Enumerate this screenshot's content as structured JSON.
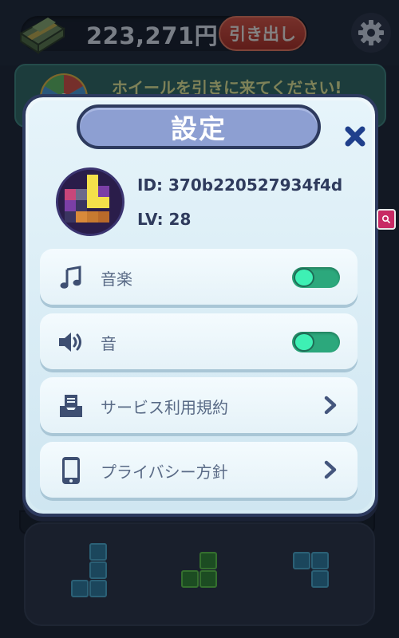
{
  "header": {
    "balance": "223,271円",
    "withdraw_label": "引き出し"
  },
  "banner": {
    "text": "ホイールを引きに来てください!"
  },
  "dialog": {
    "title": "設定",
    "player": {
      "id_text": "ID: 370b220527934f4d",
      "level_text": "LV: 28"
    },
    "rows": [
      {
        "label": "音楽",
        "icon": "music-note-icon",
        "control": "toggle",
        "on": true
      },
      {
        "label": "音",
        "icon": "speaker-icon",
        "control": "toggle",
        "on": true
      },
      {
        "label": "サービス利用規約",
        "icon": "inbox-document-icon",
        "control": "chevron"
      },
      {
        "label": "プライバシー方針",
        "icon": "smartphone-icon",
        "control": "chevron"
      }
    ]
  },
  "colors": {
    "dialog_border": "#2d3a5e",
    "title_plate": "#8d9fd2",
    "toggle_on": "#2ca87c",
    "toggle_knob": "#3ef0b4",
    "withdraw_button": "#d2432f",
    "text_dark": "#2f3b5d"
  }
}
